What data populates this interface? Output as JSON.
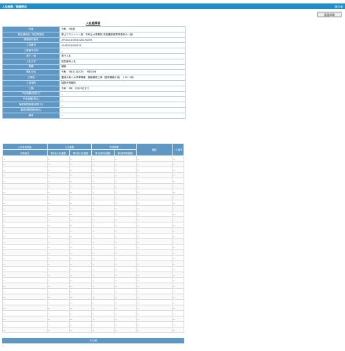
{
  "header": {
    "title": "入札結果／詳細表示",
    "right": "発注者"
  },
  "print_button": "画面印刷",
  "doc_title": "入札結果表",
  "info": [
    {
      "key": "年度",
      "value": "令和　5年度"
    },
    {
      "key": "発注部局名／発注所属名",
      "value": "県土マネジメント部　中和土木事務所(中部農林振興事務所の一部)"
    },
    {
      "key": "調達案件番号",
      "value": "29001013052020230209"
    },
    {
      "key": "工事番号",
      "value": "1305205050235"
    },
    {
      "key": "工事番号名称",
      "value": "--"
    },
    {
      "key": "電子／紙",
      "value": "電子入札"
    },
    {
      "key": "入札方式",
      "value": "指名競争入札"
    },
    {
      "key": "業種",
      "value": "舗装"
    },
    {
      "key": "開札日時",
      "value": "令和　5年11月20日　 9時30分"
    },
    {
      "key": "工事名",
      "value": "豊浦大和八木停車場線　舗装補修工事（国本舗装１他）　412−4他"
    },
    {
      "key": "工事場所",
      "value": "橿原市飛騨町"
    },
    {
      "key": "工期",
      "value": "令和　6年　2月29日まで"
    },
    {
      "key": "予定価格(税抜き)",
      "value": "--"
    },
    {
      "key": "予定価格(税込)",
      "value": "--"
    },
    {
      "key": "最低制限価格(税抜き)",
      "value": "--"
    },
    {
      "key": "最低制限価格(税込)",
      "value": "--"
    },
    {
      "key": "備考",
      "value": "--"
    }
  ],
  "results": {
    "header_row1": [
      "入札参加業者",
      "入札価格",
      "有効価格",
      "摘要",
      "ＪＶ番号"
    ],
    "header_row2": [
      "代表者名",
      "第1回入札金額",
      "第2回入札金額",
      "第1回有効価格",
      "第2回有効価格"
    ],
    "cell": "--",
    "row_count": 32
  },
  "other": {
    "title": "その他",
    "value": "--"
  }
}
